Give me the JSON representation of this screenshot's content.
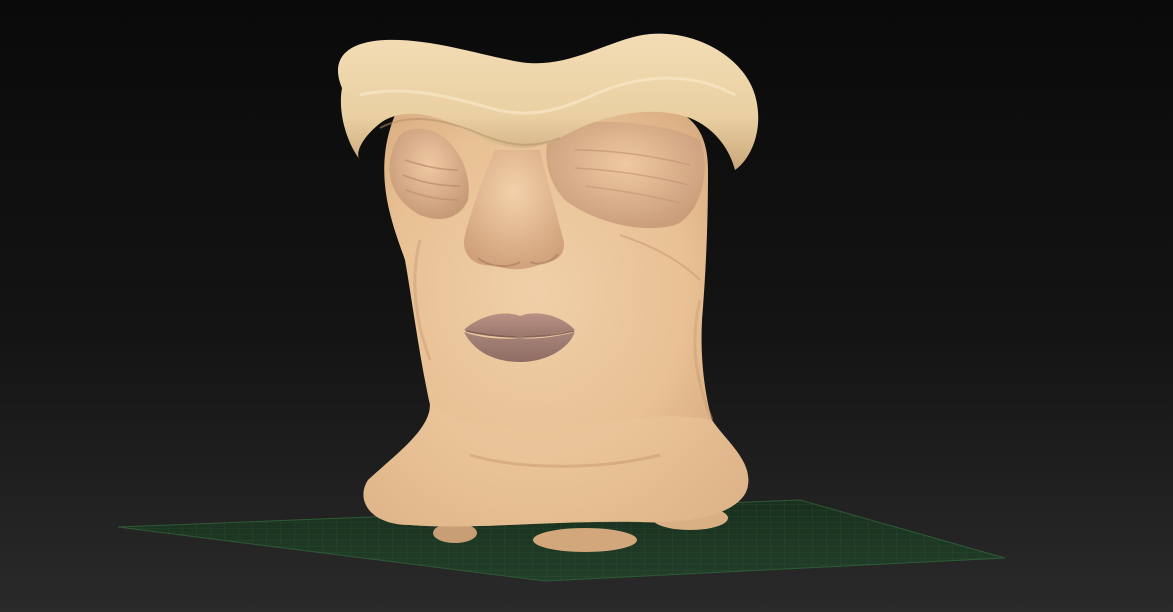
{
  "app": {
    "view": "3d-viewport"
  },
  "colors": {
    "background_top": "#0a0a0a",
    "background_bottom": "#262626",
    "floor_grid": "#2f5a36",
    "floor_fill": "#1d3322",
    "skin_light": "#efcfa3",
    "skin_mid": "#e6bf93",
    "skin_shadow": "#c79a72",
    "lip": "#a98276",
    "lip_shadow": "#8e6c63"
  },
  "scene": {
    "object": "sculpted-head-mesh",
    "floor": "grid-floor-plane"
  }
}
